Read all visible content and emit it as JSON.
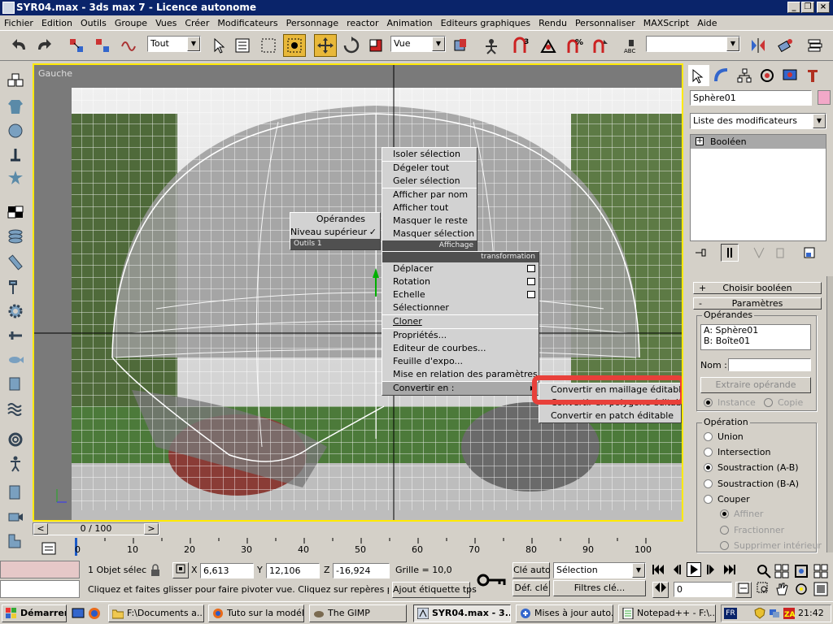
{
  "window": {
    "title": "SYR04.max - 3ds max 7 - Licence autonome",
    "btn_min": "_",
    "btn_max": "❐",
    "btn_close": "×"
  },
  "menu": [
    "Fichier",
    "Edition",
    "Outils",
    "Groupe",
    "Vues",
    "Créer",
    "Modificateurs",
    "Personnage",
    "reactor",
    "Animation",
    "Editeurs graphiques",
    "Rendu",
    "Personnaliser",
    "MAXScript",
    "Aide"
  ],
  "toolbar": {
    "selection_filter": "Tout",
    "ref_coord": "Vue",
    "named_selection": ""
  },
  "viewport": {
    "label": "Gauche"
  },
  "quad_menu": {
    "left_top": {
      "items": [
        "Opérandes",
        "Niveau supérieur"
      ],
      "footer": "Outils 1",
      "check": "✓"
    },
    "right_top": {
      "items": [
        "Isoler sélection",
        "Dégeler tout",
        "Geler sélection",
        "Afficher par nom",
        "Afficher tout",
        "Masquer le reste",
        "Masquer sélection"
      ],
      "footer": "Affichage"
    },
    "right_bottom": {
      "header": "transformation",
      "items": [
        "Déplacer",
        "Rotation",
        "Echelle",
        "Sélectionner",
        "Cloner",
        "Propriétés...",
        "Editeur de courbes...",
        "Feuille d'expo...",
        "Mise en relation des paramètres...",
        "Convertir en :"
      ],
      "arrow": "▶"
    },
    "submenu": [
      "Convertir en maillage éditable",
      "Convertir en polygone éditable",
      "Convertir en patch éditable"
    ]
  },
  "command_panel": {
    "object_name": "Sphère01",
    "modifier_list": "Liste des modificateurs",
    "stack": [
      {
        "label": "Booléen",
        "expander": "+"
      }
    ],
    "rollouts": {
      "choose_bool": {
        "label": "Choisir booléen",
        "sign": "+"
      },
      "params": {
        "label": "Paramètres",
        "sign": "-"
      }
    },
    "operands_title": "Opérandes",
    "operands": [
      "A: Sphère01",
      "B: Boîte01"
    ],
    "name_label": "Nom :",
    "extract_btn": "Extraire opérande",
    "instance": "Instance",
    "copy": "Copie",
    "operation_title": "Opération",
    "operations": [
      "Union",
      "Intersection",
      "Soustraction (A-B)",
      "Soustraction (B-A)",
      "Couper"
    ],
    "selected_operation": "Soustraction (A-B)",
    "cut_options": [
      "Affiner",
      "Fractionner",
      "Supprimer intérieur"
    ]
  },
  "timeline": {
    "frame": "0 / 100",
    "prev": "<",
    "next": ">",
    "ticks": [
      "0",
      "10",
      "20",
      "30",
      "40",
      "50",
      "60",
      "70",
      "80",
      "90",
      "100"
    ]
  },
  "status": {
    "selection": "1 Objet sélect",
    "x_label": "X",
    "x_val": "6,613",
    "y_label": "Y",
    "y_val": "12,106",
    "z_label": "Z",
    "z_val": "-16,924",
    "grid": "Grille = 10,0",
    "prompt": "Cliquez et faites glisser pour faire pivoter vue. Cliquez sur repères pour détermi",
    "add_tag": "Ajout étiquette tps",
    "auto_key": "Clé auto",
    "set_key": "Déf. clé",
    "sel_combo": "Sélection",
    "filters": "Filtres clé...",
    "frame_field": "0"
  },
  "taskbar": {
    "start": "Démarrer",
    "tasks": [
      "F:\\Documents a...",
      "Tuto sur la modél...",
      "The GIMP",
      "SYR04.max - 3...",
      "Mises à jour auto...",
      "Notepad++ - F:\\..."
    ],
    "lang": "FR",
    "clock": "21:42"
  },
  "colors": {
    "accent_highlight": "#e8403a",
    "viewport_border": "#ffea00",
    "title_bg": "#0a246a"
  }
}
